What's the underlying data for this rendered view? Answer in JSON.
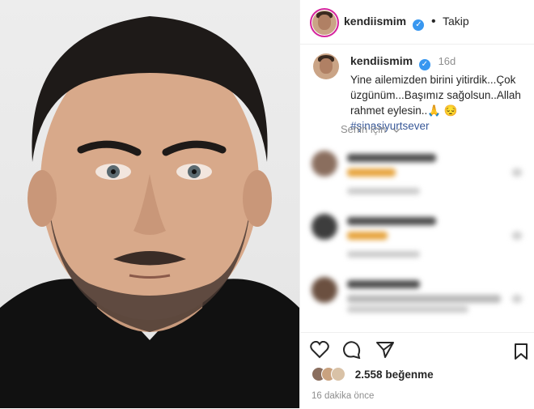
{
  "post": {
    "username": "kendiismim",
    "follow_label": "Takip",
    "separator": "•",
    "caption_age": "16d",
    "caption_text": "Yine ailemizden birini yitirdik...Çok üzgünüm...Başımız sağolsun..Allah rahmet eylesin..🙏 😔",
    "hashtag": "#şinasiyurtsever",
    "sort_label": "Senin için",
    "likes_count": "2.558",
    "likes_suffix": "beğenme",
    "timestamp": "16 dakika önce"
  },
  "icons": {
    "like": "heart-icon",
    "comment": "comment-icon",
    "share": "share-icon",
    "save": "bookmark-icon",
    "verified": "verified-badge-icon",
    "sort": "chevron-down-icon"
  },
  "colors": {
    "verified": "#3897f0",
    "hashtag": "#385898",
    "muted": "#8e8e8e"
  }
}
